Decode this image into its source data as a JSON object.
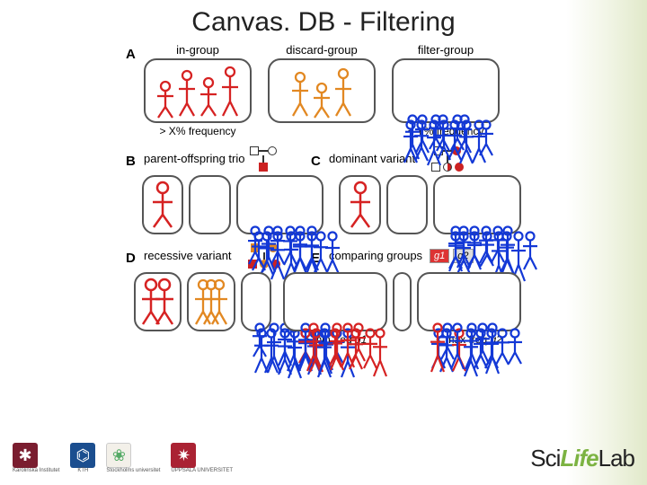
{
  "title": "Canvas. DB - Filtering",
  "panels": {
    "A": "A",
    "B": "B",
    "C": "C",
    "D": "D",
    "E": "E"
  },
  "A": {
    "in_group": {
      "label": "in-group",
      "freq": "> X% frequency"
    },
    "discard_group": {
      "label": "discard-group"
    },
    "filter_group": {
      "label": "filter-group",
      "freq": "< Y% frequency"
    }
  },
  "B": {
    "label": "parent-offspring trio"
  },
  "C": {
    "label": "dominant variant"
  },
  "D": {
    "label": "recessive variant"
  },
  "E": {
    "label": "comparing groups",
    "g1": "g1",
    "g2": "g2",
    "min": "> min freq",
    "min_g": "g1",
    "max": "< max freq",
    "max_g": "g2"
  },
  "colors": {
    "red": "#d62222",
    "orange": "#e28822",
    "blue": "#1338d6"
  },
  "footer": {
    "ki": "Karolinska Institutet",
    "kth": "KTH",
    "su": "Stockholms universitet",
    "uu": "UPPSALA UNIVERSITET",
    "sll_sci": "Sci",
    "sll_life": "Life",
    "sll_lab": "Lab"
  }
}
